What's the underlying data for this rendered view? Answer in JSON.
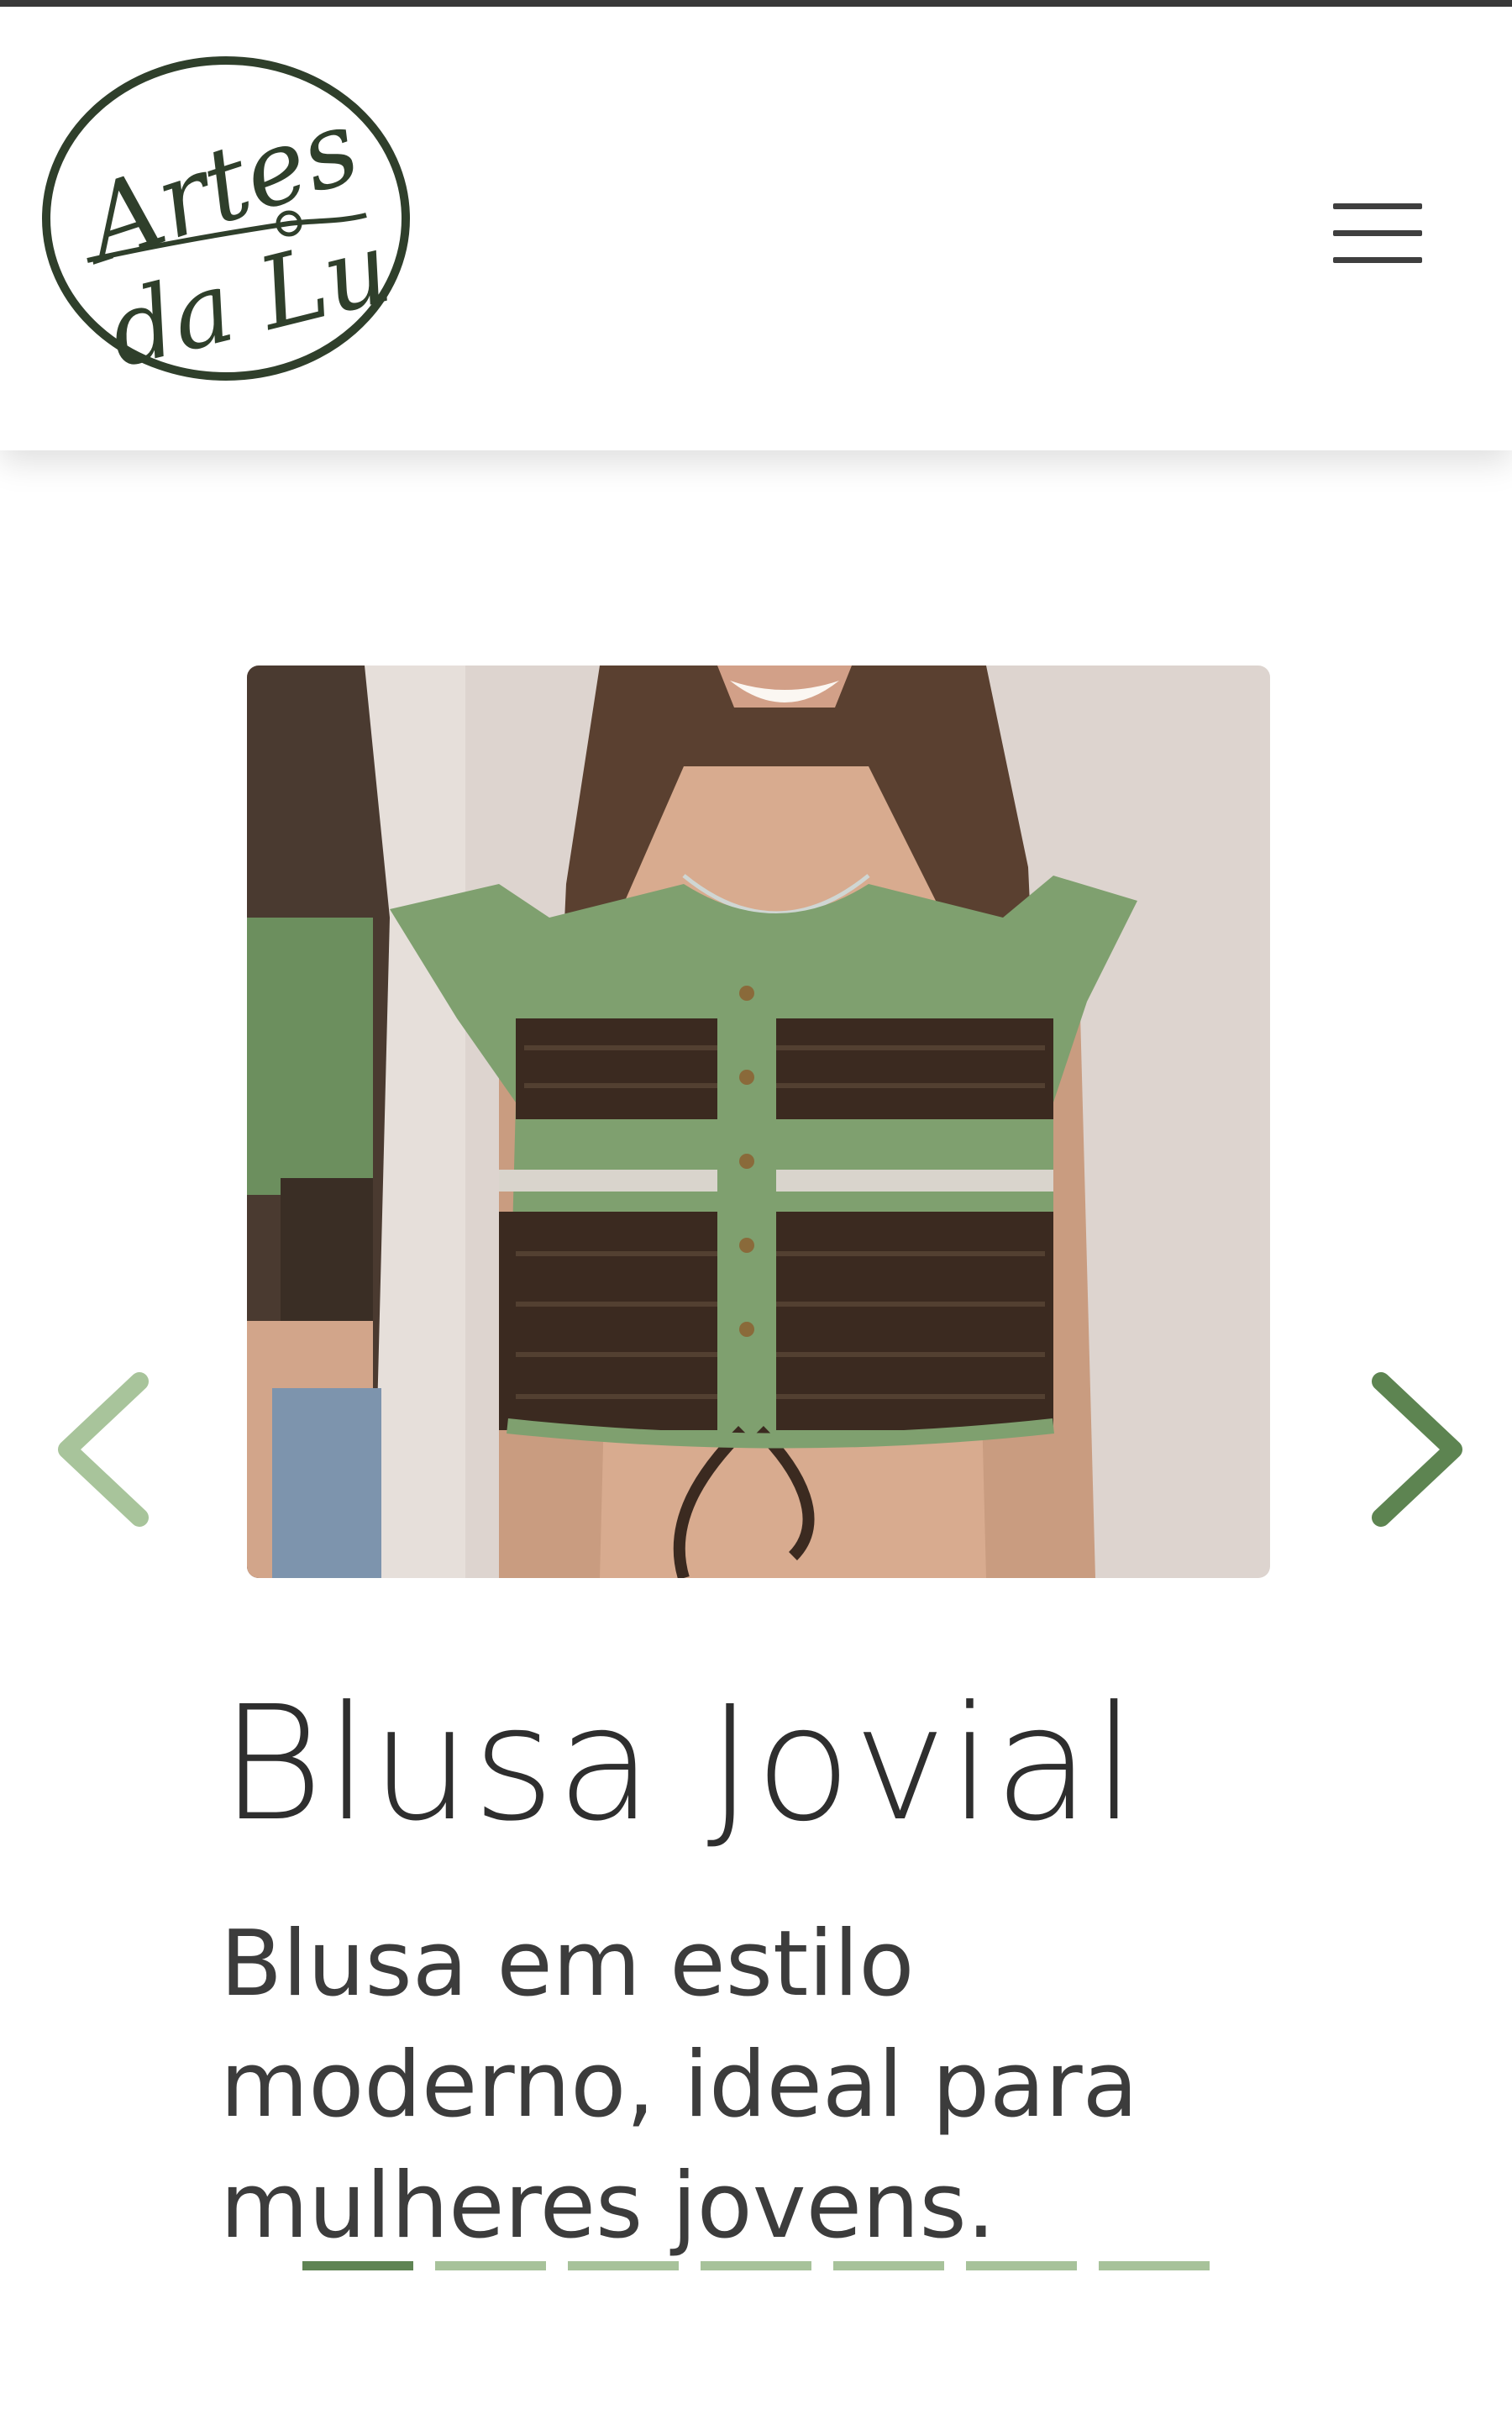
{
  "brand": {
    "logo_line1": "Artes",
    "logo_line2": "da Lu",
    "logo_color": "#2f3f2b"
  },
  "header": {
    "menu_label": "menu-icon"
  },
  "slide": {
    "image_alt": "Blusa Jovial",
    "title": "Blusa Jovial",
    "description": "Blusa em estilo moderno, ideal para mulheres jovens."
  },
  "carousel": {
    "total_slides": 7,
    "active_index": 0,
    "prev_icon": "chevron-left-icon",
    "next_icon": "chevron-right-icon"
  },
  "colors": {
    "accent_dark": "#5f8453",
    "accent_light": "#a7c29a",
    "arrow_prev": "#a8c49b",
    "arrow_next": "#5d8451"
  }
}
